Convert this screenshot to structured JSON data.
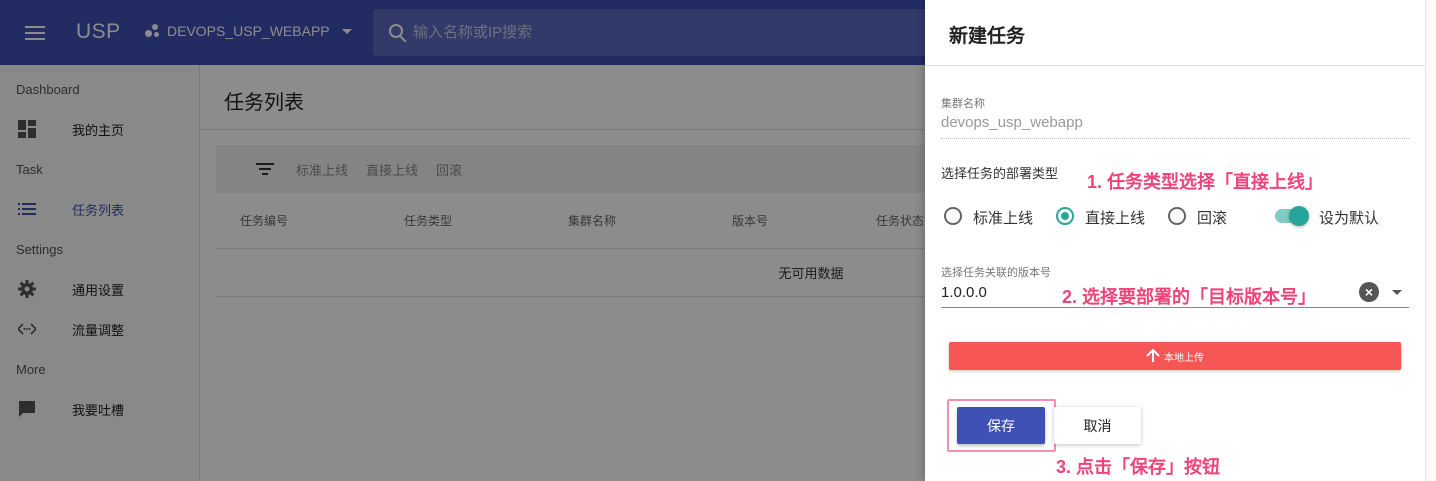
{
  "header": {
    "app_title": "USP",
    "project": "DEVOPS_USP_WEBAPP",
    "search_placeholder": "输入名称或IP搜索"
  },
  "sidebar": {
    "sections": [
      {
        "label": "Dashboard",
        "items": [
          {
            "label": "我的主页",
            "icon": "dashboard-icon"
          }
        ]
      },
      {
        "label": "Task",
        "items": [
          {
            "label": "任务列表",
            "icon": "list-icon",
            "active": true
          }
        ]
      },
      {
        "label": "Settings",
        "items": [
          {
            "label": "通用设置",
            "icon": "gear-icon"
          },
          {
            "label": "流量调整",
            "icon": "code-icon"
          }
        ]
      },
      {
        "label": "More",
        "items": [
          {
            "label": "我要吐槽",
            "icon": "feedback-icon"
          }
        ]
      }
    ]
  },
  "main": {
    "title": "任务列表",
    "toolbar": [
      "标准上线",
      "直接上线",
      "回滚"
    ],
    "columns": [
      "任务编号",
      "任务类型",
      "集群名称",
      "版本号",
      "任务状态"
    ],
    "empty_text": "无可用数据"
  },
  "drawer": {
    "title": "新建任务",
    "cluster_label": "集群名称",
    "cluster_value": "devops_usp_webapp",
    "deploy_type_label": "选择任务的部署类型",
    "deploy_options": [
      "标准上线",
      "直接上线",
      "回滚"
    ],
    "selected_option": "直接上线",
    "default_switch_label": "设为默认",
    "default_switch_on": true,
    "version_label": "选择任务关联的版本号",
    "version_value": "1.0.0.0",
    "upload_label": "本地上传",
    "save_label": "保存",
    "cancel_label": "取消"
  },
  "annotations": {
    "step1": "1. 任务类型选择「直接上线」",
    "step2": "2. 选择要部署的「目标版本号」",
    "step3": "3. 点击「保存」按钮"
  },
  "colors": {
    "primary": "#3f51b5",
    "accent": "#26a69a",
    "upload": "#f65656",
    "annotation": "#f0437a"
  }
}
